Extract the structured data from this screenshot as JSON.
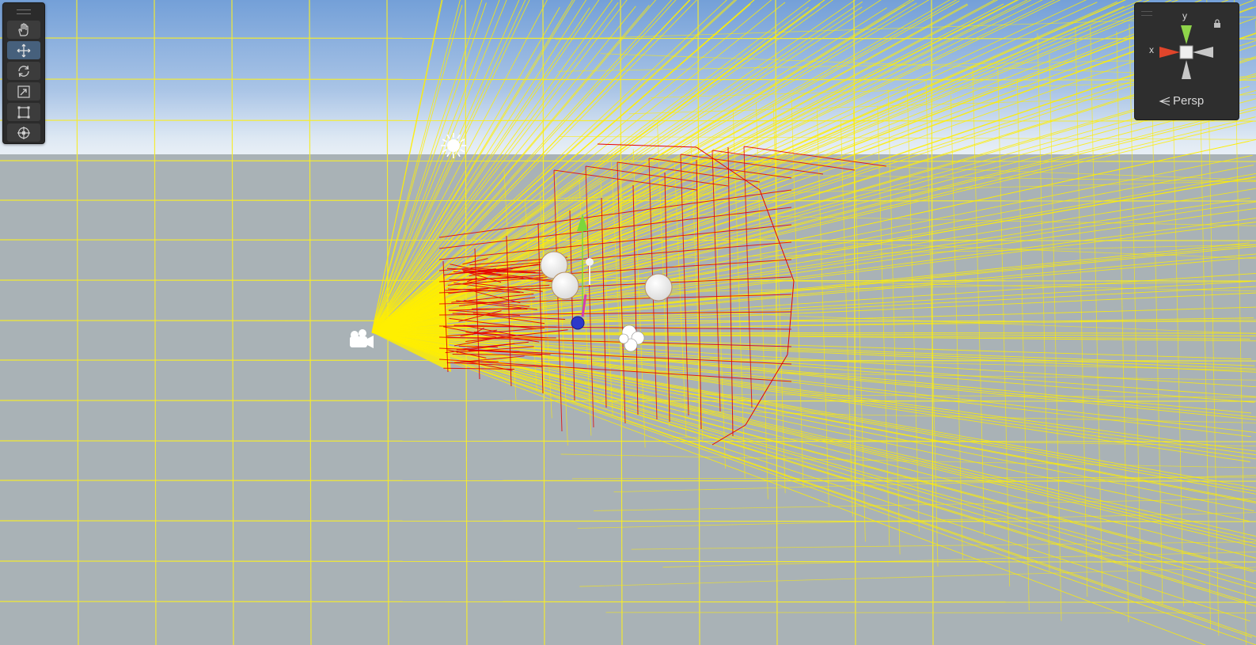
{
  "scene": {
    "view": "scene-view",
    "sky_top": "#7aa3d8",
    "sky_horizon": "#e6eef6",
    "ground": "#a9b2b6",
    "grid_color": "#f5ec2a",
    "frustum_color": "#ffee00",
    "volume_color": "#e60000"
  },
  "toolbar": {
    "tools": [
      {
        "name": "hand-tool",
        "icon": "hand-icon"
      },
      {
        "name": "move-tool",
        "icon": "move-icon",
        "active": true
      },
      {
        "name": "rotate-tool",
        "icon": "rotate-icon"
      },
      {
        "name": "scale-tool",
        "icon": "scale-icon"
      },
      {
        "name": "rect-tool",
        "icon": "rect-icon"
      },
      {
        "name": "transform-tool",
        "icon": "transform-icon"
      }
    ]
  },
  "gizmo": {
    "x_label": "x",
    "y_label": "y",
    "projection_label": "Persp",
    "lock_icon": "lock-icon"
  }
}
